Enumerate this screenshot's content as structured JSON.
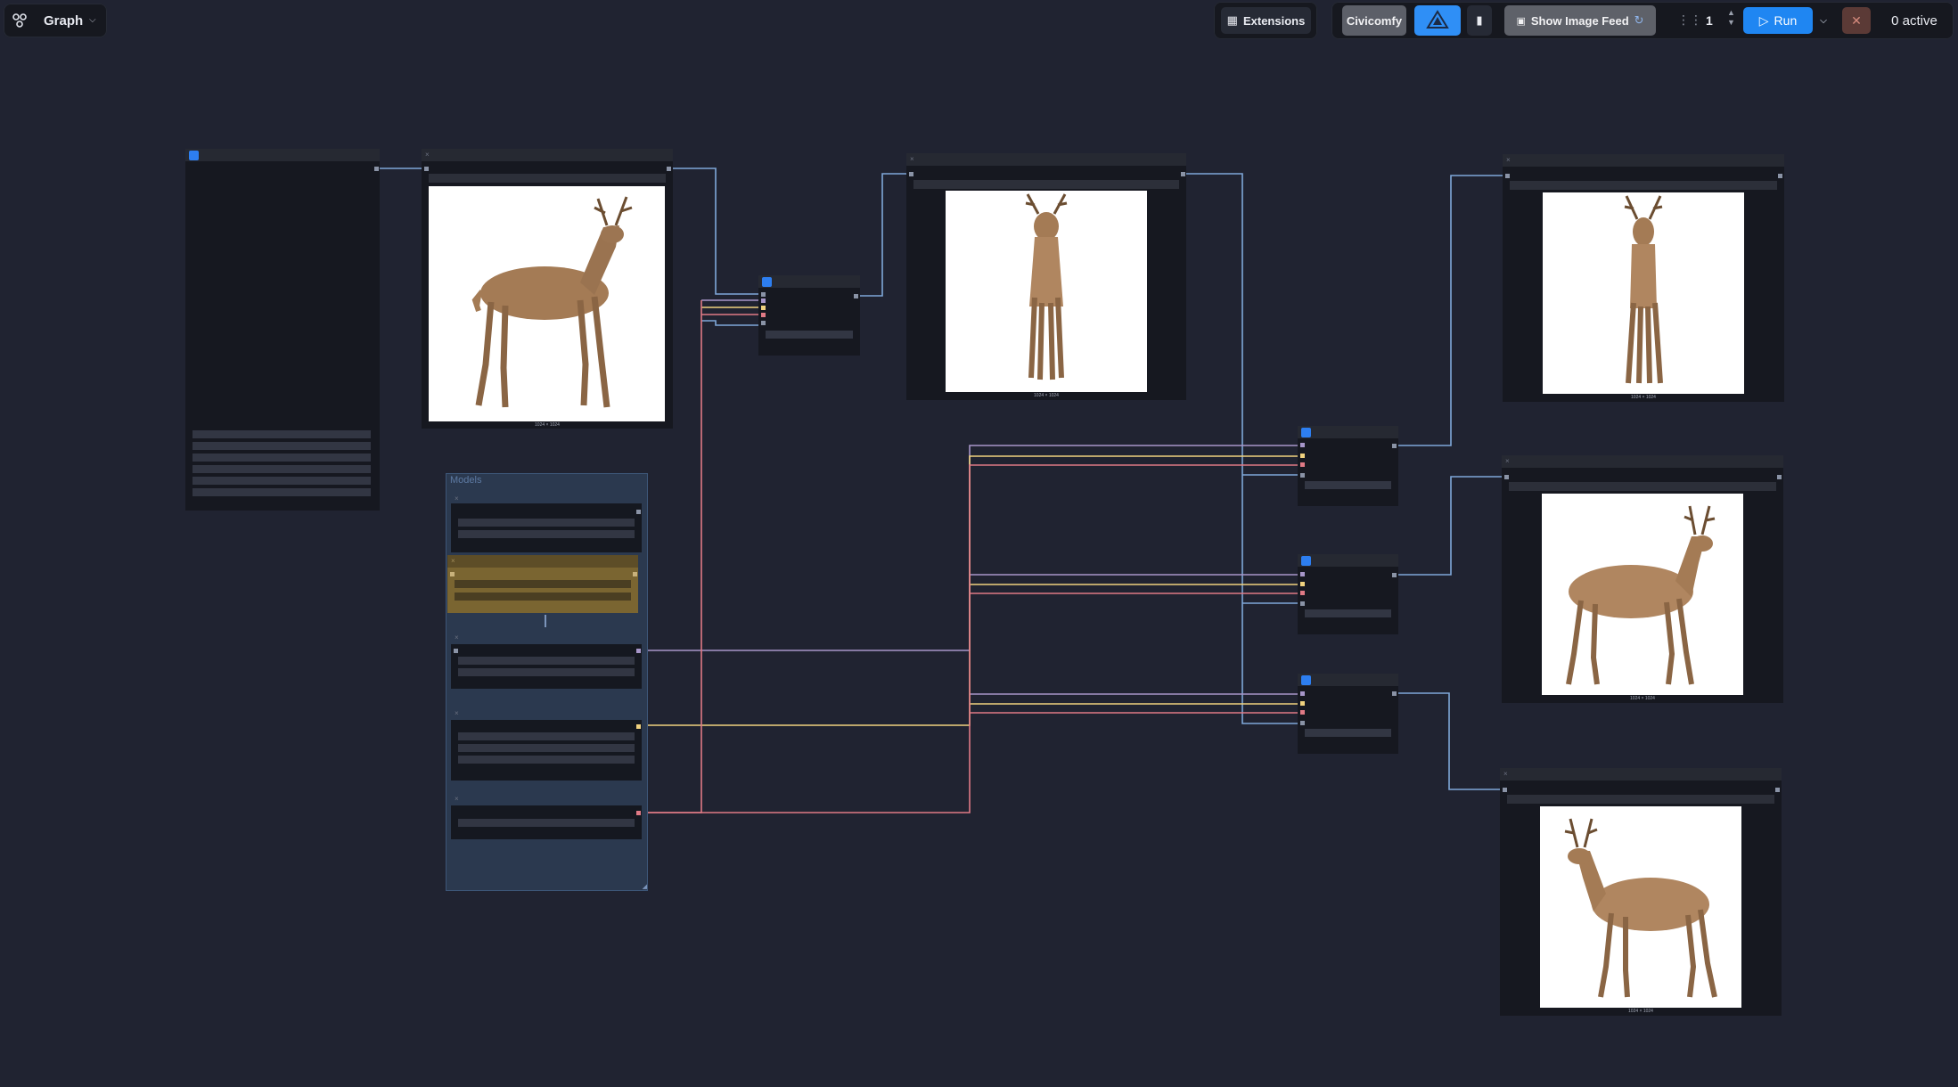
{
  "toolbar": {
    "workflow_label": "Graph",
    "extensions_label": "Extensions",
    "civicomfy_label": "Civicomfy",
    "show_image_feed_label": "Show Image Feed",
    "queue_count": "1",
    "run_label": "Run",
    "active_label": "0 active"
  },
  "groups": {
    "models_title": "Models"
  },
  "images": {
    "caption_1": "1024 × 1024",
    "caption_2": "1024 × 1024",
    "caption_3": "1024 × 1024",
    "caption_4": "1024 × 1024",
    "caption_5": "1024 × 1024"
  },
  "colors": {
    "canvas": "#202331",
    "node_bg": "#161820",
    "accent_blue": "#2d7ef0",
    "wire_blue": "#7fa8d9",
    "wire_lavender": "#a796c9",
    "wire_yellow": "#f0d27f",
    "wire_pink": "#e07a86",
    "wire_red": "#d9666f"
  },
  "icons": [
    "graph-icon",
    "chevron-down-icon",
    "extensions-icon",
    "civicomfy-logo-icon",
    "bookmark-icon",
    "image-feed-icon",
    "drag-handle-icon",
    "stepper-icon",
    "play-icon",
    "close-icon"
  ]
}
